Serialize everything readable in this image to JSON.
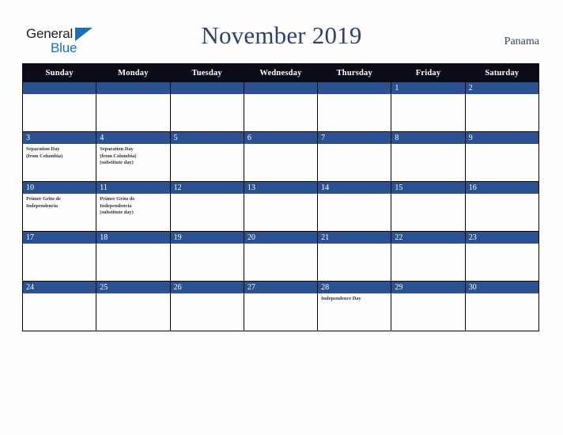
{
  "logo": {
    "word_one": "General",
    "word_two": "Blue",
    "triangle_icon": "triangle-icon",
    "brand_blue": "#1a71b8",
    "brand_dark": "#231f20"
  },
  "header": {
    "title": "November 2019",
    "country": "Panama",
    "title_color": "#2f4268"
  },
  "theme": {
    "weekday_header_bg": "#0c0c16",
    "daynum_band_bg": "#2b5191",
    "cell_bg": "#fdfdfd",
    "page_bg": "#fdfdfd",
    "grid_line": "#000000"
  },
  "calendar": {
    "weekdays": [
      "Sunday",
      "Monday",
      "Tuesday",
      "Wednesday",
      "Thursday",
      "Friday",
      "Saturday"
    ],
    "weeks": [
      [
        {
          "day": "",
          "events": []
        },
        {
          "day": "",
          "events": []
        },
        {
          "day": "",
          "events": []
        },
        {
          "day": "",
          "events": []
        },
        {
          "day": "",
          "events": []
        },
        {
          "day": "1",
          "events": []
        },
        {
          "day": "2",
          "events": []
        }
      ],
      [
        {
          "day": "3",
          "events": [
            "Separation Day",
            "(from Columbia)"
          ]
        },
        {
          "day": "4",
          "events": [
            "Separation Day",
            "(from Columbia)",
            "(substitute day)"
          ]
        },
        {
          "day": "5",
          "events": []
        },
        {
          "day": "6",
          "events": []
        },
        {
          "day": "7",
          "events": []
        },
        {
          "day": "8",
          "events": []
        },
        {
          "day": "9",
          "events": []
        }
      ],
      [
        {
          "day": "10",
          "events": [
            "Primer Grito de",
            "Independencia"
          ]
        },
        {
          "day": "11",
          "events": [
            "Primer Grito de",
            "Independencia",
            "(substitute day)"
          ]
        },
        {
          "day": "12",
          "events": []
        },
        {
          "day": "13",
          "events": []
        },
        {
          "day": "14",
          "events": []
        },
        {
          "day": "15",
          "events": []
        },
        {
          "day": "16",
          "events": []
        }
      ],
      [
        {
          "day": "17",
          "events": []
        },
        {
          "day": "18",
          "events": []
        },
        {
          "day": "19",
          "events": []
        },
        {
          "day": "20",
          "events": []
        },
        {
          "day": "21",
          "events": []
        },
        {
          "day": "22",
          "events": []
        },
        {
          "day": "23",
          "events": []
        }
      ],
      [
        {
          "day": "24",
          "events": []
        },
        {
          "day": "25",
          "events": []
        },
        {
          "day": "26",
          "events": []
        },
        {
          "day": "27",
          "events": []
        },
        {
          "day": "28",
          "events": [
            "Independence Day"
          ]
        },
        {
          "day": "29",
          "events": []
        },
        {
          "day": "30",
          "events": []
        }
      ]
    ]
  }
}
